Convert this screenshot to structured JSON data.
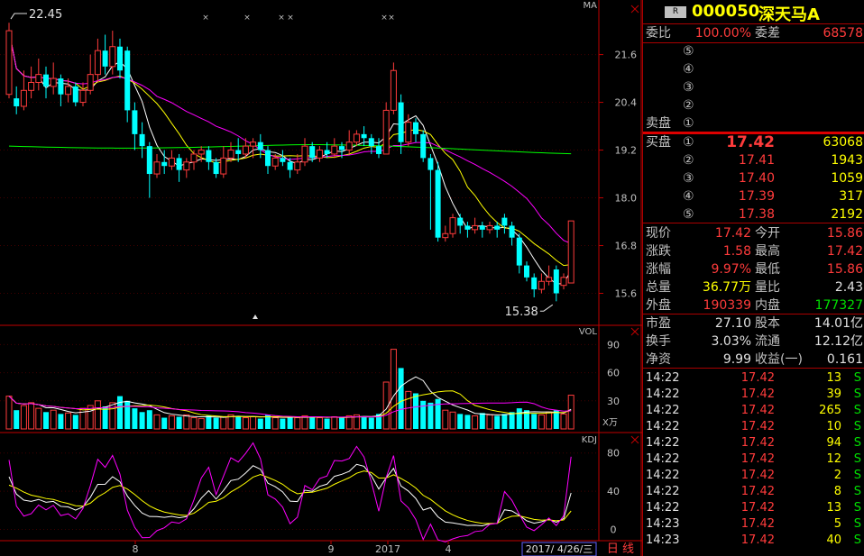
{
  "chart": {
    "ma_label": "MA",
    "vol_label": "VOL",
    "kdj_label": "KDJ",
    "price_high_label": "22.45",
    "price_low_label": "15.38",
    "vol_unit": "X万",
    "price_ticks": [
      "21.6",
      "20.4",
      "19.2",
      "18.0",
      "16.8",
      "15.6"
    ],
    "vol_ticks": [
      "90",
      "60",
      "30"
    ],
    "kdj_ticks": [
      "80",
      "40",
      "0"
    ],
    "date_ticks": [
      "8",
      "9",
      "2017",
      "4"
    ],
    "current_date": "2017/ 4/26/三",
    "period": "日 线",
    "colors": {
      "up": "#ff3b3b",
      "down": "#00ffff",
      "ma5": "#ffffff",
      "ma10": "#ffff00",
      "ma20": "#ff00ff",
      "ma60": "#00ff00",
      "axis": "#c00000"
    }
  },
  "quote": {
    "badge": "R",
    "code": "000050",
    "name": "深天马A",
    "weibi_label": "委比",
    "weibi_value": "100.00%",
    "weicha_label": "委差",
    "weicha_value": "68578",
    "sell_label": "卖盘",
    "buy_label": "买盘",
    "sell_levels": [
      "⑤",
      "④",
      "③",
      "②",
      "①"
    ],
    "buy_levels": [
      {
        "idx": "①",
        "price": "17.42",
        "vol": "63068"
      },
      {
        "idx": "②",
        "price": "17.41",
        "vol": "1943"
      },
      {
        "idx": "③",
        "price": "17.40",
        "vol": "1059"
      },
      {
        "idx": "④",
        "price": "17.39",
        "vol": "317"
      },
      {
        "idx": "⑤",
        "price": "17.38",
        "vol": "2192"
      }
    ],
    "stats": [
      {
        "l1": "现价",
        "v1": "17.42",
        "c1": "red",
        "l2": "今开",
        "v2": "15.86",
        "c2": "red"
      },
      {
        "l1": "涨跌",
        "v1": "1.58",
        "c1": "red",
        "l2": "最高",
        "v2": "17.42",
        "c2": "red"
      },
      {
        "l1": "涨幅",
        "v1": "9.97%",
        "c1": "red",
        "l2": "最低",
        "v2": "15.86",
        "c2": "red"
      },
      {
        "l1": "总量",
        "v1": "36.77万",
        "c1": "yel",
        "l2": "量比",
        "v2": "2.43",
        "c2": "wht"
      },
      {
        "l1": "外盘",
        "v1": "190339",
        "c1": "red",
        "l2": "内盘",
        "v2": "177327",
        "c2": "grn"
      }
    ],
    "fund": [
      {
        "l1": "市盈",
        "v1": "27.10",
        "l2": "股本",
        "v2": "14.01亿"
      },
      {
        "l1": "换手",
        "v1": "3.03%",
        "l2": "流通",
        "v2": "12.12亿"
      },
      {
        "l1": "净资",
        "v1": "9.99",
        "l2": "收益(一)",
        "v2": "0.161"
      }
    ],
    "ticks": [
      {
        "t": "14:22",
        "p": "17.42",
        "v": "13",
        "s": "S"
      },
      {
        "t": "14:22",
        "p": "17.42",
        "v": "39",
        "s": "S"
      },
      {
        "t": "14:22",
        "p": "17.42",
        "v": "265",
        "s": "S"
      },
      {
        "t": "14:22",
        "p": "17.42",
        "v": "10",
        "s": "S"
      },
      {
        "t": "14:22",
        "p": "17.42",
        "v": "94",
        "s": "S"
      },
      {
        "t": "14:22",
        "p": "17.42",
        "v": "12",
        "s": "S"
      },
      {
        "t": "14:22",
        "p": "17.42",
        "v": "2",
        "s": "S"
      },
      {
        "t": "14:22",
        "p": "17.42",
        "v": "8",
        "s": "S"
      },
      {
        "t": "14:22",
        "p": "17.42",
        "v": "13",
        "s": "S"
      },
      {
        "t": "14:23",
        "p": "17.42",
        "v": "5",
        "s": "S"
      },
      {
        "t": "14:23",
        "p": "17.42",
        "v": "40",
        "s": "S"
      }
    ]
  },
  "chart_data": {
    "type": "candlestick",
    "y_range": [
      15.0,
      22.7
    ],
    "candles": [
      [
        20.6,
        22.2,
        22.4,
        20.5
      ],
      [
        20.5,
        20.3,
        20.8,
        20.1
      ],
      [
        20.3,
        20.7,
        21.2,
        20.2
      ],
      [
        20.7,
        20.9,
        21.3,
        20.5
      ],
      [
        20.9,
        21.1,
        21.5,
        20.7
      ],
      [
        21.1,
        20.8,
        21.3,
        20.5
      ],
      [
        20.8,
        21.0,
        21.4,
        20.6
      ],
      [
        21.0,
        20.6,
        21.1,
        20.3
      ],
      [
        20.6,
        20.8,
        21.0,
        20.4
      ],
      [
        20.8,
        20.4,
        20.9,
        20.3
      ],
      [
        20.4,
        20.7,
        20.9,
        20.3
      ],
      [
        20.7,
        21.1,
        21.6,
        20.6
      ],
      [
        21.1,
        21.7,
        22.0,
        20.9
      ],
      [
        21.7,
        21.3,
        22.1,
        21.1
      ],
      [
        21.3,
        21.8,
        22.2,
        21.1
      ],
      [
        21.8,
        21.2,
        22.0,
        21.0
      ],
      [
        21.7,
        20.2,
        21.8,
        19.9
      ],
      [
        20.2,
        19.6,
        20.4,
        19.2
      ],
      [
        19.6,
        19.3,
        19.9,
        19.0
      ],
      [
        19.3,
        18.6,
        19.4,
        18.0
      ],
      [
        18.6,
        18.9,
        19.1,
        18.5
      ],
      [
        18.9,
        18.8,
        19.2,
        18.6
      ],
      [
        18.8,
        19.0,
        19.2,
        18.7
      ],
      [
        19.0,
        18.7,
        19.1,
        18.4
      ],
      [
        18.7,
        18.9,
        19.0,
        18.5
      ],
      [
        18.9,
        19.1,
        19.2,
        18.7
      ],
      [
        19.1,
        19.2,
        19.3,
        18.9
      ],
      [
        19.2,
        18.9,
        19.3,
        18.7
      ],
      [
        18.9,
        18.6,
        19.0,
        18.5
      ],
      [
        18.6,
        19.0,
        19.3,
        18.5
      ],
      [
        19.0,
        19.2,
        19.4,
        18.9
      ],
      [
        19.2,
        19.1,
        19.5,
        18.9
      ],
      [
        19.1,
        19.3,
        19.5,
        19.0
      ],
      [
        19.3,
        19.4,
        19.5,
        19.0
      ],
      [
        19.4,
        19.2,
        19.6,
        19.0
      ],
      [
        19.2,
        18.8,
        19.3,
        18.6
      ],
      [
        18.8,
        19.0,
        19.1,
        18.7
      ],
      [
        19.0,
        18.9,
        19.2,
        18.8
      ],
      [
        18.9,
        18.7,
        19.0,
        18.5
      ],
      [
        18.7,
        18.9,
        19.1,
        18.6
      ],
      [
        18.9,
        19.3,
        19.5,
        18.8
      ],
      [
        19.3,
        19.0,
        19.4,
        18.9
      ],
      [
        19.0,
        19.2,
        19.3,
        18.9
      ],
      [
        19.2,
        19.1,
        19.4,
        19.0
      ],
      [
        19.1,
        19.3,
        19.5,
        19.0
      ],
      [
        19.3,
        19.2,
        19.4,
        19.0
      ],
      [
        19.2,
        19.4,
        19.7,
        19.1
      ],
      [
        19.4,
        19.6,
        19.7,
        19.3
      ],
      [
        19.6,
        19.5,
        19.8,
        19.3
      ],
      [
        19.5,
        19.3,
        19.6,
        19.1
      ],
      [
        19.3,
        19.1,
        19.5,
        19.0
      ],
      [
        19.1,
        20.2,
        20.4,
        19.1
      ],
      [
        20.2,
        21.2,
        21.4,
        20.1
      ],
      [
        20.4,
        19.4,
        20.6,
        19.1
      ],
      [
        19.4,
        19.9,
        20.1,
        19.3
      ],
      [
        19.9,
        19.6,
        20.0,
        19.4
      ],
      [
        19.6,
        19.0,
        19.7,
        18.9
      ],
      [
        19.0,
        18.7,
        19.1,
        17.2
      ],
      [
        18.7,
        17.0,
        18.9,
        16.9
      ],
      [
        17.0,
        17.1,
        17.3,
        16.9
      ],
      [
        17.1,
        17.5,
        17.6,
        17.0
      ],
      [
        17.5,
        17.3,
        17.6,
        17.1
      ],
      [
        17.3,
        17.2,
        17.4,
        17.0
      ],
      [
        17.2,
        17.3,
        17.5,
        17.1
      ],
      [
        17.3,
        17.2,
        17.4,
        17.0
      ],
      [
        17.2,
        17.3,
        17.4,
        17.1
      ],
      [
        17.3,
        17.2,
        17.4,
        17.0
      ],
      [
        17.5,
        17.3,
        17.6,
        17.1
      ],
      [
        17.3,
        17.0,
        17.4,
        16.8
      ],
      [
        17.0,
        16.3,
        17.1,
        16.1
      ],
      [
        16.3,
        16.0,
        16.4,
        15.9
      ],
      [
        16.0,
        15.7,
        16.1,
        15.5
      ],
      [
        15.7,
        15.9,
        16.1,
        15.6
      ],
      [
        15.9,
        16.0,
        16.3,
        15.8
      ],
      [
        16.2,
        15.6,
        16.3,
        15.4
      ],
      [
        15.8,
        16.0,
        16.1,
        15.7
      ],
      [
        15.86,
        17.42,
        17.42,
        15.86
      ]
    ],
    "volume": [
      35,
      20,
      25,
      28,
      22,
      18,
      20,
      16,
      17,
      15,
      22,
      25,
      30,
      24,
      28,
      35,
      30,
      22,
      18,
      20,
      15,
      12,
      14,
      13,
      15,
      12,
      11,
      14,
      12,
      13,
      15,
      14,
      12,
      13,
      11,
      15,
      12,
      11,
      13,
      12,
      14,
      13,
      12,
      11,
      13,
      12,
      14,
      15,
      13,
      12,
      16,
      50,
      85,
      65,
      40,
      38,
      30,
      28,
      32,
      20,
      18,
      16,
      15,
      14,
      17,
      15,
      14,
      16,
      18,
      22,
      20,
      16,
      15,
      18,
      20,
      16,
      36
    ]
  }
}
